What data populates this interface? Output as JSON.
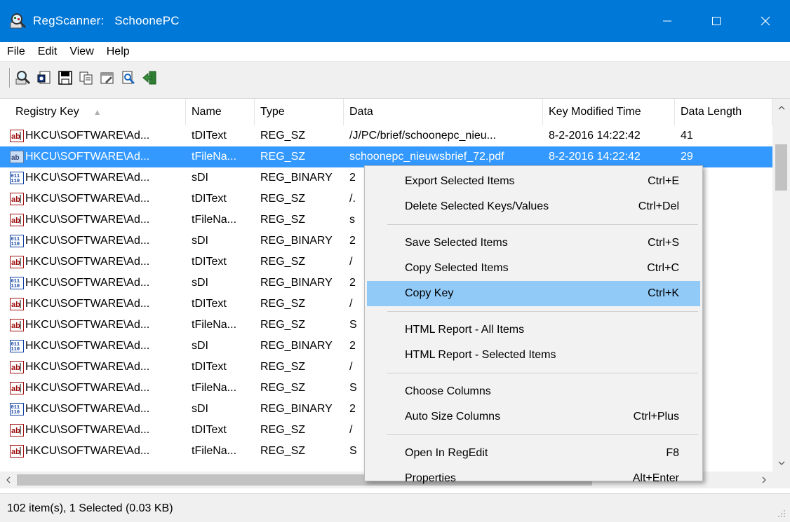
{
  "window": {
    "title": "RegScanner:   SchoonePC",
    "icon": "regscanner-app-icon",
    "minimize_label": "—",
    "maximize_label": "☐",
    "close_label": "✕"
  },
  "menu": [
    "File",
    "Edit",
    "View",
    "Help"
  ],
  "toolbar": {
    "buttons": [
      "new-scan-icon",
      "open-regedit-icon",
      "save-icon",
      "copy-icon",
      "properties-icon",
      "find-icon",
      "exit-icon"
    ]
  },
  "columns": [
    {
      "label": "Registry Key",
      "sort": "▲"
    },
    {
      "label": "Name"
    },
    {
      "label": "Type"
    },
    {
      "label": "Data"
    },
    {
      "label": "Key Modified Time"
    },
    {
      "label": "Data Length"
    }
  ],
  "rows": [
    {
      "icon": "ab",
      "key": "HKCU\\SOFTWARE\\Ad...",
      "name": "tDIText",
      "type": "REG_SZ",
      "data": "/J/PC/brief/schoonepc_nieu...",
      "time": "8-2-2016 14:22:42",
      "length": "41"
    },
    {
      "icon": "ab",
      "key": "HKCU\\SOFTWARE\\Ad...",
      "name": "tFileNa...",
      "type": "REG_SZ",
      "data": "schoonepc_nieuwsbrief_72.pdf",
      "time": "8-2-2016 14:22:42",
      "length": "29"
    },
    {
      "icon": "bin",
      "key": "HKCU\\SOFTWARE\\Ad...",
      "name": "sDI",
      "type": "REG_BINARY",
      "data": "2",
      "time": "",
      "length": ""
    },
    {
      "icon": "ab",
      "key": "HKCU\\SOFTWARE\\Ad...",
      "name": "tDIText",
      "type": "REG_SZ",
      "data": "/.",
      "time": "",
      "length": ""
    },
    {
      "icon": "ab",
      "key": "HKCU\\SOFTWARE\\Ad...",
      "name": "tFileNa...",
      "type": "REG_SZ",
      "data": "s",
      "time": "",
      "length": ""
    },
    {
      "icon": "bin",
      "key": "HKCU\\SOFTWARE\\Ad...",
      "name": "sDI",
      "type": "REG_BINARY",
      "data": "2",
      "time": "",
      "length": ""
    },
    {
      "icon": "ab",
      "key": "HKCU\\SOFTWARE\\Ad...",
      "name": "tDIText",
      "type": "REG_SZ",
      "data": "/",
      "time": "",
      "length": ""
    },
    {
      "icon": "bin",
      "key": "HKCU\\SOFTWARE\\Ad...",
      "name": "sDI",
      "type": "REG_BINARY",
      "data": "2",
      "time": "",
      "length": ""
    },
    {
      "icon": "ab",
      "key": "HKCU\\SOFTWARE\\Ad...",
      "name": "tDIText",
      "type": "REG_SZ",
      "data": "/",
      "time": "",
      "length": ""
    },
    {
      "icon": "ab",
      "key": "HKCU\\SOFTWARE\\Ad...",
      "name": "tFileNa...",
      "type": "REG_SZ",
      "data": "S",
      "time": "",
      "length": ""
    },
    {
      "icon": "bin",
      "key": "HKCU\\SOFTWARE\\Ad...",
      "name": "sDI",
      "type": "REG_BINARY",
      "data": "2",
      "time": "",
      "length": ""
    },
    {
      "icon": "ab",
      "key": "HKCU\\SOFTWARE\\Ad...",
      "name": "tDIText",
      "type": "REG_SZ",
      "data": "/",
      "time": "",
      "length": ""
    },
    {
      "icon": "ab",
      "key": "HKCU\\SOFTWARE\\Ad...",
      "name": "tFileNa...",
      "type": "REG_SZ",
      "data": "S",
      "time": "",
      "length": ""
    },
    {
      "icon": "bin",
      "key": "HKCU\\SOFTWARE\\Ad...",
      "name": "sDI",
      "type": "REG_BINARY",
      "data": "2",
      "time": "",
      "length": ""
    },
    {
      "icon": "ab",
      "key": "HKCU\\SOFTWARE\\Ad...",
      "name": "tDIText",
      "type": "REG_SZ",
      "data": "/",
      "time": "",
      "length": ""
    },
    {
      "icon": "ab",
      "key": "HKCU\\SOFTWARE\\Ad...",
      "name": "tFileNa...",
      "type": "REG_SZ",
      "data": "S",
      "time": "",
      "length": ""
    }
  ],
  "selected_row": 1,
  "context_menu": {
    "groups": [
      [
        {
          "label": "Export Selected Items",
          "shortcut": "Ctrl+E"
        },
        {
          "label": "Delete Selected Keys/Values",
          "shortcut": "Ctrl+Del"
        }
      ],
      [
        {
          "label": "Save Selected Items",
          "shortcut": "Ctrl+S"
        },
        {
          "label": "Copy Selected Items",
          "shortcut": "Ctrl+C"
        },
        {
          "label": "Copy Key",
          "shortcut": "Ctrl+K",
          "highlighted": true
        }
      ],
      [
        {
          "label": "HTML Report - All Items",
          "shortcut": ""
        },
        {
          "label": "HTML Report - Selected Items",
          "shortcut": ""
        }
      ],
      [
        {
          "label": "Choose Columns",
          "shortcut": ""
        },
        {
          "label": "Auto Size Columns",
          "shortcut": "Ctrl+Plus"
        }
      ],
      [
        {
          "label": "Open In RegEdit",
          "shortcut": "F8"
        },
        {
          "label": "Properties",
          "shortcut": "Alt+Enter"
        }
      ]
    ]
  },
  "status": "102 item(s), 1 Selected  (0.03 KB)",
  "colors": {
    "titlebar": "#0078d7",
    "selection": "#3399ff",
    "menu_highlight": "#91c9f7"
  }
}
